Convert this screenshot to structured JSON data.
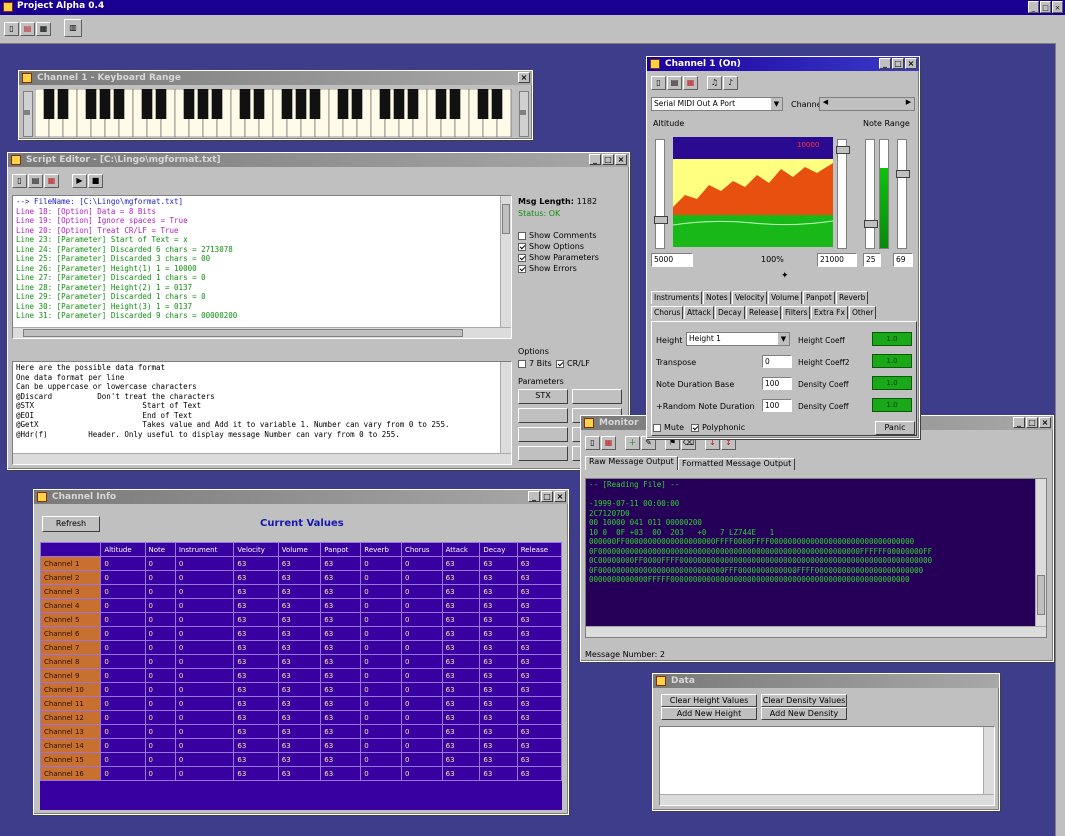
{
  "app": {
    "title": "Project Alpha 0.4",
    "toolbar": [
      "new-icon",
      "open-icon",
      "save-icon",
      "keyboard-icon"
    ]
  },
  "piano": {
    "title": "Channel 1 - Keyboard Range"
  },
  "script_editor": {
    "title": "Script Editor - [C:\\Lingo\\mgformat.txt]",
    "lines": [
      {
        "text": "--> FileName: [C:\\Lingo\\mgformat.txt]",
        "color": "#2020c0"
      },
      {
        "text": "Line 18: [Option] Data = 8 Bits",
        "color": "#b020c0"
      },
      {
        "text": "Line 19: [Option] Ignore spaces = True",
        "color": "#b020c0"
      },
      {
        "text": "Line 20: [Option] Treat CR/LF = True",
        "color": "#b020c0"
      },
      {
        "text": "Line 23: [Parameter] Start of Text = x",
        "color": "#109010"
      },
      {
        "text": "Line 24: [Parameter] Discarded 6 chars = 2713078",
        "color": "#109010"
      },
      {
        "text": "Line 25: [Parameter] Discarded 3 chars = 00",
        "color": "#109010"
      },
      {
        "text": "Line 26: [Parameter] Height(1) 1 = 10000",
        "color": "#109010"
      },
      {
        "text": "Line 27: [Parameter] Discarded 1 chars = 0",
        "color": "#109010"
      },
      {
        "text": "Line 28: [Parameter] Height(2) 1 = 0137",
        "color": "#109010"
      },
      {
        "text": "Line 29: [Parameter] Discarded 1 chars = 0",
        "color": "#109010"
      },
      {
        "text": "Line 30: [Parameter] Height(3) 1 = 0137",
        "color": "#109010"
      },
      {
        "text": "Line 31: [Parameter] Discarded 9 chars = 00000200",
        "color": "#109010"
      }
    ],
    "desc_lines": [
      "Here are the possible data format",
      "One data format per line",
      "Can be uppercase or lowercase characters",
      "@Discard          Don't treat the characters",
      "@STX                        Start of Text",
      "@EOI                        End of Text",
      "@GetX                       Takes value and Add it to variable 1. Number can vary from 0 to 255.",
      "@Hdr(f)         Header. Only useful to display message Number can vary from 0 to 255."
    ],
    "msg_length_label": "Msg Length:",
    "msg_length_value": "1182",
    "status": "Status: OK",
    "checkboxes": [
      {
        "label": "Show Comments",
        "checked": false
      },
      {
        "label": "Show Options",
        "checked": true
      },
      {
        "label": "Show Parameters",
        "checked": true
      },
      {
        "label": "Show Errors",
        "checked": true
      }
    ],
    "options_label": "Options",
    "opt_7bits": "7 Bits",
    "opt_crlf": "CR/LF",
    "parameters_label": "Parameters",
    "param_buttons": [
      "STX",
      "",
      "",
      "",
      "",
      "",
      "",
      ""
    ]
  },
  "channel_info": {
    "title": "Channel Info",
    "refresh_label": "Refresh",
    "heading": "Current Values",
    "columns": [
      "",
      "Altitude",
      "Note",
      "Instrument",
      "Velocity",
      "Volume",
      "Panpot",
      "Reverb",
      "Chorus",
      "Attack",
      "Decay",
      "Release"
    ],
    "rows": [
      [
        "Channel 1",
        "0",
        "0",
        "0",
        "63",
        "63",
        "63",
        "0",
        "0",
        "63",
        "63",
        "63"
      ],
      [
        "Channel 2",
        "0",
        "0",
        "0",
        "63",
        "63",
        "63",
        "0",
        "0",
        "63",
        "63",
        "63"
      ],
      [
        "Channel 3",
        "0",
        "0",
        "0",
        "63",
        "63",
        "63",
        "0",
        "0",
        "63",
        "63",
        "63"
      ],
      [
        "Channel 4",
        "0",
        "0",
        "0",
        "63",
        "63",
        "63",
        "0",
        "0",
        "63",
        "63",
        "63"
      ],
      [
        "Channel 5",
        "0",
        "0",
        "0",
        "63",
        "63",
        "63",
        "0",
        "0",
        "63",
        "63",
        "63"
      ],
      [
        "Channel 6",
        "0",
        "0",
        "0",
        "63",
        "63",
        "63",
        "0",
        "0",
        "63",
        "63",
        "63"
      ],
      [
        "Channel 7",
        "0",
        "0",
        "0",
        "63",
        "63",
        "63",
        "0",
        "0",
        "63",
        "63",
        "63"
      ],
      [
        "Channel 8",
        "0",
        "0",
        "0",
        "63",
        "63",
        "63",
        "0",
        "0",
        "63",
        "63",
        "63"
      ],
      [
        "Channel 9",
        "0",
        "0",
        "0",
        "63",
        "63",
        "63",
        "0",
        "0",
        "63",
        "63",
        "63"
      ],
      [
        "Channel 10",
        "0",
        "0",
        "0",
        "63",
        "63",
        "63",
        "0",
        "0",
        "63",
        "63",
        "63"
      ],
      [
        "Channel 11",
        "0",
        "0",
        "0",
        "63",
        "63",
        "63",
        "0",
        "0",
        "63",
        "63",
        "63"
      ],
      [
        "Channel 12",
        "0",
        "0",
        "0",
        "63",
        "63",
        "63",
        "0",
        "0",
        "63",
        "63",
        "63"
      ],
      [
        "Channel 13",
        "0",
        "0",
        "0",
        "63",
        "63",
        "63",
        "0",
        "0",
        "63",
        "63",
        "63"
      ],
      [
        "Channel 14",
        "0",
        "0",
        "0",
        "63",
        "63",
        "63",
        "0",
        "0",
        "63",
        "63",
        "63"
      ],
      [
        "Channel 15",
        "0",
        "0",
        "0",
        "63",
        "63",
        "63",
        "0",
        "0",
        "63",
        "63",
        "63"
      ],
      [
        "Channel 16",
        "0",
        "0",
        "0",
        "63",
        "63",
        "63",
        "0",
        "0",
        "63",
        "63",
        "63"
      ]
    ]
  },
  "channel1": {
    "title": "Channel 1 (On)",
    "port": "Serial MIDI Out A Port",
    "channel_label": "Channel",
    "altitude_label": "Altitude",
    "note_range_label": "Note Range",
    "graph_value": "10000",
    "field_min": "5000",
    "field_pct": "100%",
    "field_max": "21000",
    "range_lo": "25",
    "range_hi": "69",
    "tabs_row1": [
      "Instruments",
      "Notes",
      "Velocity",
      "Volume",
      "Panpot",
      "Reverb"
    ],
    "tabs_row2": [
      "Chorus",
      "Attack",
      "Decay",
      "Release",
      "Filters",
      "Extra Fx",
      "Other"
    ],
    "height_label": "Height",
    "height_select": "Height 1",
    "transpose_label": "Transpose",
    "transpose_value": "0",
    "note_dur_label": "Note Duration Base",
    "note_dur_value": "100",
    "rand_dur_label": "+Random Note Duration",
    "rand_dur_value": "100",
    "coeffs": [
      "Height Coeff",
      "Height Coeff2",
      "Density Coeff",
      "Density Coeff"
    ],
    "coeff_values": [
      "1.0",
      "1.0",
      "1.0",
      "1.0"
    ],
    "mute_label": "Mute",
    "polyphonic_label": "Polyphonic",
    "panic_label": "Panic"
  },
  "monitor": {
    "title": "Monitor",
    "tab_raw": "Raw Message Output",
    "tab_formatted": "Formatted Message Output",
    "lines": [
      "-- [Reading File] --",
      "",
      "-1999-07-11 00:00:00",
      "2C71207D0",
      "00 10000 041 011 00000200",
      "10 0  0F +03  00  203   +0   7 LZ744E   1",
      "000000FF00000000000000000000FFFF0000FFFF00000000000000000000000000000000",
      "0F0000000000000000000000000000000000000000000000000000000000FFFFFF00000000FF",
      "0C00000000FF0000FFFF00000000000000000000000000000000000000000000000000000000",
      "0F0000000000000000000000000000FFF0000000000000FFFF000000000000000000000000",
      "0000000000000FFFFF00000000000000000000000000000000000000000000000000000"
    ],
    "message_number_label": "Message Number:",
    "message_number_value": "2"
  },
  "data_panel": {
    "title": "Data",
    "clear_height": "Clear Height Values",
    "clear_density": "Clear Density Values",
    "add_height": "Add New Height",
    "add_density": "Add New Density"
  }
}
